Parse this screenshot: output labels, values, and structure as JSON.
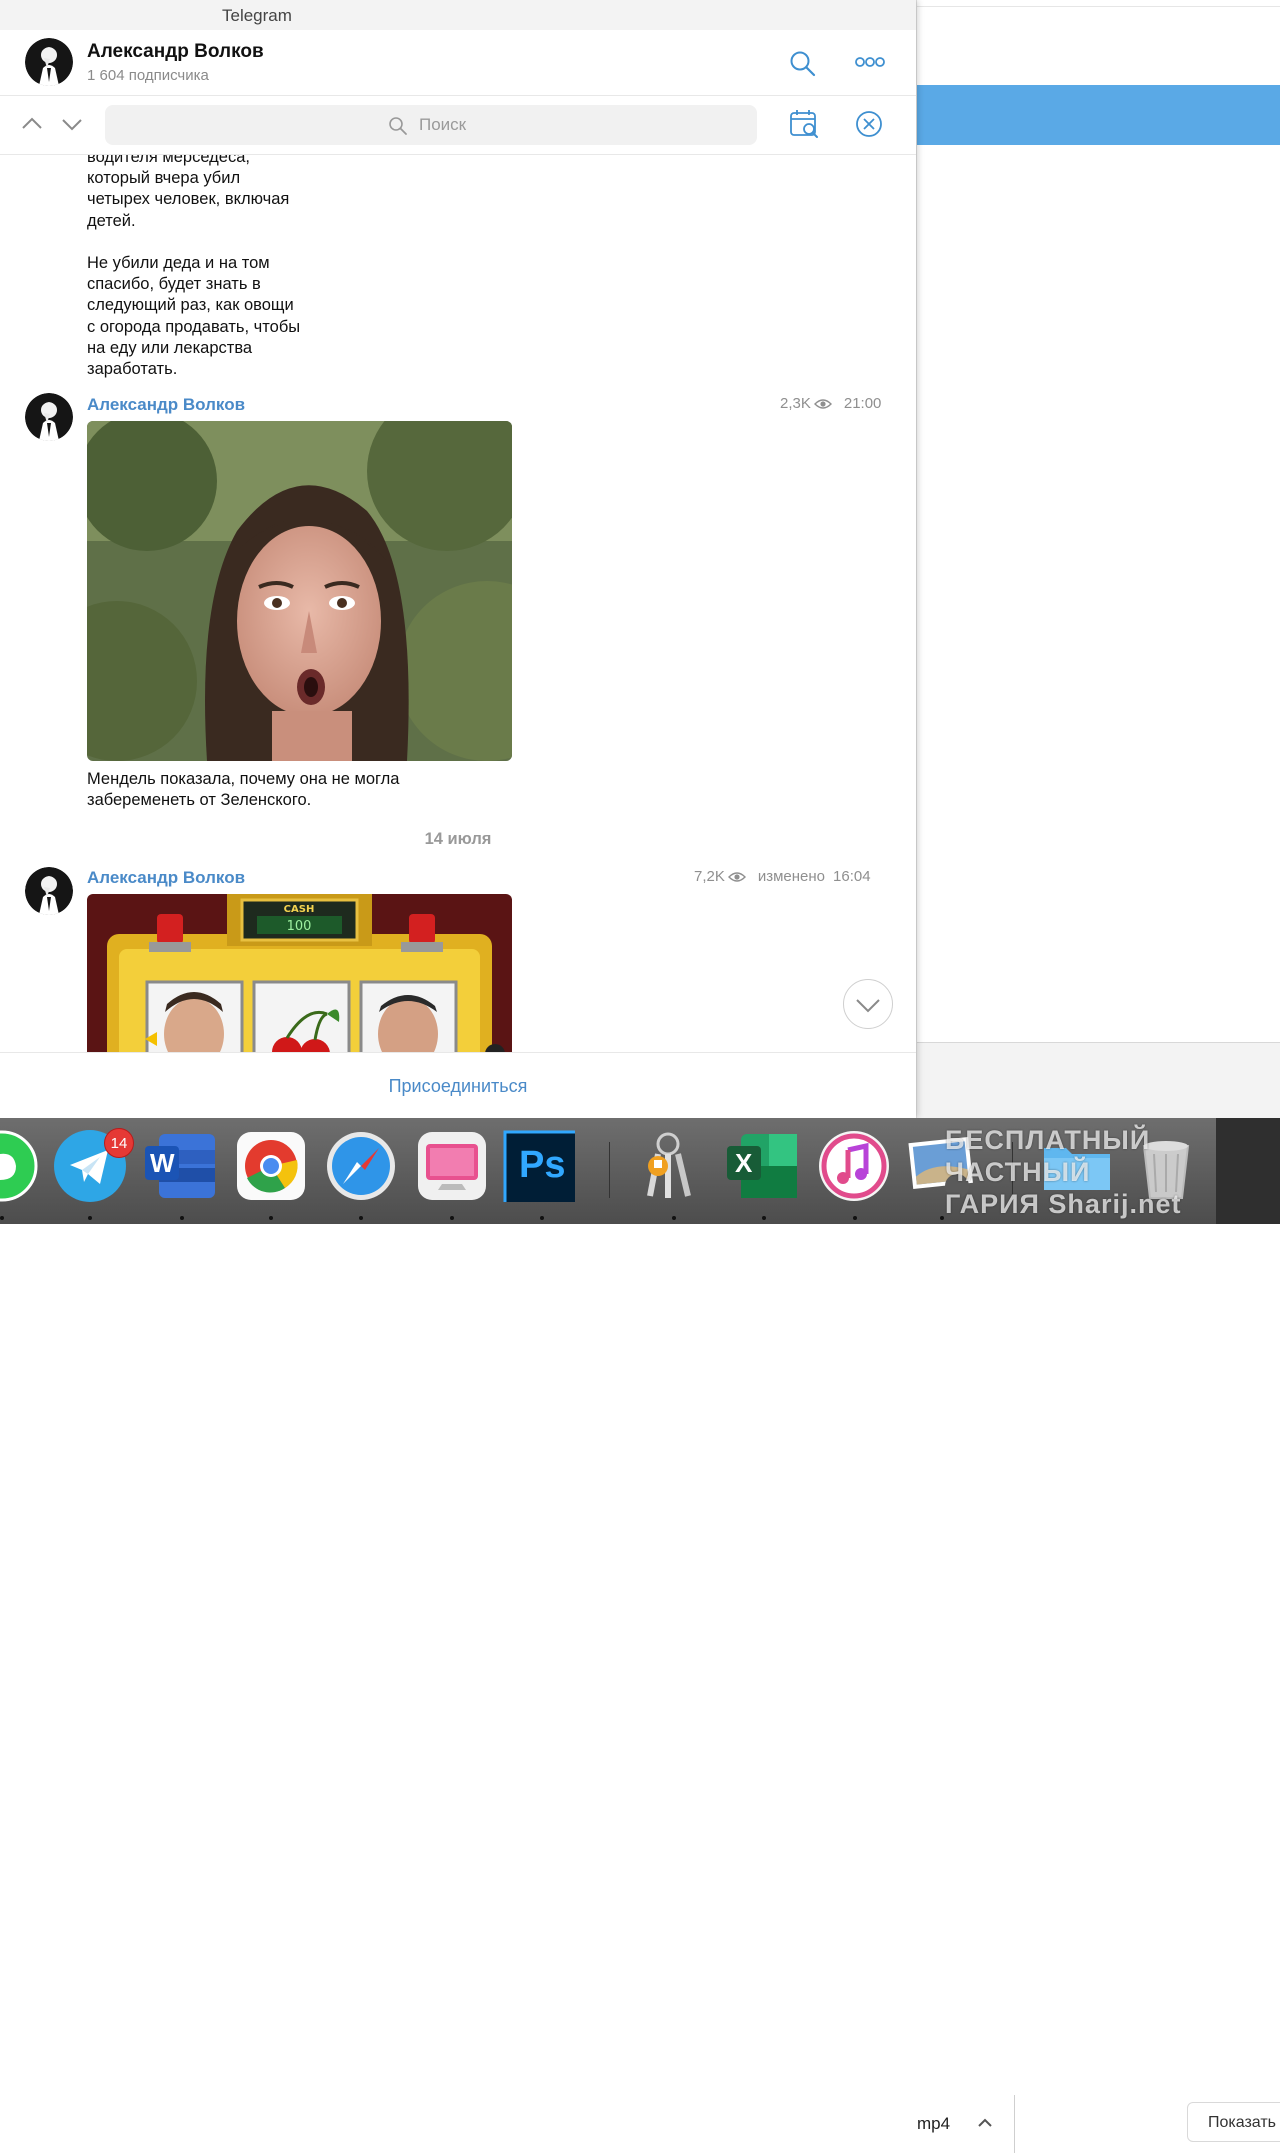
{
  "app": {
    "title": "Telegram"
  },
  "header": {
    "channel_name": "Александр Волков",
    "subscribers": "1 604 подписчика"
  },
  "search": {
    "placeholder": "Поиск"
  },
  "messages": [
    {
      "text": "водителя мерседеса,\nкоторый вчера убил\nчетырех человек, включая\nдетей.\n\nНе убили деда и на том\nспасибо, будет знать в\nследующий раз, как овощи\nс огорода продавать, чтобы\nна еду или лекарства\nзаработать."
    },
    {
      "sender": "Александр Волков",
      "views": "2,3K",
      "time": "21:00",
      "caption": "Мендель показала, почему она не могла\nзабеременеть от Зеленского."
    },
    {
      "sender": "Александр Волков",
      "views": "7,2K",
      "edited": "изменено",
      "time": "16:04",
      "photo_sign": "CASH",
      "photo_counter": "100"
    }
  ],
  "date_divider": "14 июля",
  "join_button": "Присоединиться",
  "background_window": {
    "file_label": "mp4",
    "show_button": "Показать"
  },
  "dock": {
    "badge_count": "14",
    "icons": [
      "whatsapp-icon",
      "telegram-icon",
      "word-icon",
      "chrome-icon",
      "safari-icon",
      "cleanmymac-icon",
      "photoshop-icon",
      "keychain-icon",
      "excel-icon",
      "itunes-icon",
      "preview-icon",
      "folder-icon",
      "trash-icon"
    ],
    "word_letter": "W",
    "ps_letters": "Ps",
    "excel_letter": "X",
    "watermark_line1": "БЕСПЛАТНЫЙ ЧАСТНЫЙ",
    "watermark_line2": "ГАРИЯ Sharij.net"
  },
  "colors": {
    "accent": "#4a8ac8",
    "bluebar": "#5aa9e6",
    "badge": "#e53935"
  }
}
